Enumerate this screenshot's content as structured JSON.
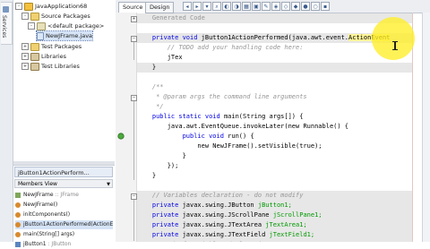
{
  "left_strip": {
    "tab_label": "Services"
  },
  "projects_tree": {
    "items": [
      {
        "label": "JavaApplication68",
        "toggle": "-",
        "icon": "project-icon"
      },
      {
        "label": "Source Packages",
        "toggle": "-",
        "icon": "source-packages-icon"
      },
      {
        "label": "<default package>",
        "toggle": "-",
        "icon": "package-icon"
      },
      {
        "label": "NewJFrame.java",
        "toggle": "",
        "icon": "java-file-icon"
      },
      {
        "label": "Test Packages",
        "toggle": "+",
        "icon": "test-packages-icon"
      },
      {
        "label": "Libraries",
        "toggle": "+",
        "icon": "libraries-icon"
      },
      {
        "label": "Test Libraries",
        "toggle": "+",
        "icon": "test-libraries-icon"
      }
    ]
  },
  "navigator": {
    "title": "jButton1ActionPerform...",
    "view_label": "Members View",
    "items": [
      {
        "name": "NewJFrame",
        "type": " :: JFrame",
        "kind": "class"
      },
      {
        "name": "NewJFrame()",
        "type": "",
        "kind": "method"
      },
      {
        "name": "initComponents()",
        "type": "",
        "kind": "method"
      },
      {
        "name": "jButton1ActionPerformed(ActionE",
        "type": "",
        "kind": "method"
      },
      {
        "name": "main(String[] args)",
        "type": "",
        "kind": "method"
      },
      {
        "name": "jButton1",
        "type": " : JButton",
        "kind": "field"
      }
    ]
  },
  "editor": {
    "tabs": {
      "source": "Source",
      "design": "Design"
    },
    "toolbar_buttons": [
      "◂",
      "▸",
      "▾",
      "⌕",
      "◐",
      "◑",
      "▦",
      "▣",
      "✎",
      "◈",
      "◇",
      "◆",
      "●",
      "○",
      "▪"
    ],
    "lines": [
      {
        "segments": [
          {
            "t": "    Generated Code",
            "s": "c"
          }
        ],
        "guarded": true
      },
      {
        "segments": [
          {
            "t": "",
            "s": ""
          }
        ],
        "guarded": false
      },
      {
        "segments": [
          {
            "t": "    private void ",
            "s": "k"
          },
          {
            "t": "jButton1ActionPerformed(java.awt.event.",
            "s": ""
          },
          {
            "t": "ActionEvent",
            "s": "hl"
          }
        ],
        "guarded": true
      },
      {
        "segments": [
          {
            "t": "        // TODO add your handling code here:",
            "s": "cm"
          }
        ],
        "guarded": false
      },
      {
        "segments": [
          {
            "t": "        jTex",
            "s": ""
          }
        ],
        "guarded": false
      },
      {
        "segments": [
          {
            "t": "    }",
            "s": ""
          }
        ],
        "guarded": true
      },
      {
        "segments": [
          {
            "t": "",
            "s": ""
          }
        ],
        "guarded": false
      },
      {
        "segments": [
          {
            "t": "    /**",
            "s": "cm"
          }
        ],
        "guarded": false
      },
      {
        "segments": [
          {
            "t": "     * @param args the command line arguments",
            "s": "cm"
          }
        ],
        "guarded": false
      },
      {
        "segments": [
          {
            "t": "     */",
            "s": "cm"
          }
        ],
        "guarded": false
      },
      {
        "segments": [
          {
            "t": "    public static void ",
            "s": "k"
          },
          {
            "t": "main(String args[]) {",
            "s": ""
          }
        ],
        "guarded": false
      },
      {
        "segments": [
          {
            "t": "        java.awt.EventQueue.",
            "s": ""
          },
          {
            "t": "invokeLater",
            "s": ""
          },
          {
            "t": "(new Runnable() {",
            "s": ""
          }
        ],
        "guarded": false
      },
      {
        "segments": [
          {
            "t": "            public void ",
            "s": "k"
          },
          {
            "t": "run() {",
            "s": ""
          }
        ],
        "guarded": false
      },
      {
        "segments": [
          {
            "t": "                new NewJFrame().setVisible(true);",
            "s": ""
          }
        ],
        "guarded": false
      },
      {
        "segments": [
          {
            "t": "            }",
            "s": ""
          }
        ],
        "guarded": false
      },
      {
        "segments": [
          {
            "t": "        });",
            "s": ""
          }
        ],
        "guarded": false
      },
      {
        "segments": [
          {
            "t": "    }",
            "s": ""
          }
        ],
        "guarded": false
      },
      {
        "segments": [
          {
            "t": "",
            "s": ""
          }
        ],
        "guarded": false
      },
      {
        "segments": [
          {
            "t": "    // Variables declaration - do not modify",
            "s": "cm"
          }
        ],
        "guarded": true
      },
      {
        "segments": [
          {
            "t": "    private ",
            "s": "k"
          },
          {
            "t": "javax.swing.JButton ",
            "s": ""
          },
          {
            "t": "jButton1;",
            "s": "f"
          }
        ],
        "guarded": true
      },
      {
        "segments": [
          {
            "t": "    private ",
            "s": "k"
          },
          {
            "t": "javax.swing.JScrollPane ",
            "s": ""
          },
          {
            "t": "jScrollPane1;",
            "s": "f"
          }
        ],
        "guarded": true
      },
      {
        "segments": [
          {
            "t": "    private ",
            "s": "k"
          },
          {
            "t": "javax.swing.JTextArea ",
            "s": ""
          },
          {
            "t": "jTextArea1;",
            "s": "f"
          }
        ],
        "guarded": true
      },
      {
        "segments": [
          {
            "t": "    private ",
            "s": "k"
          },
          {
            "t": "javax.swing.JTextField ",
            "s": ""
          },
          {
            "t": "jTextField1;",
            "s": "f"
          }
        ],
        "guarded": true
      },
      {
        "segments": [
          {
            "t": "    // End of variables declaration",
            "s": "cm"
          }
        ],
        "guarded": true
      }
    ]
  },
  "colors": {
    "keyword": "#0000e6",
    "comment": "#969696",
    "field": "#009900",
    "guarded_bg": "#e7e7e7",
    "highlight": "#fff59a",
    "pointer_glow": "#ffee28"
  }
}
